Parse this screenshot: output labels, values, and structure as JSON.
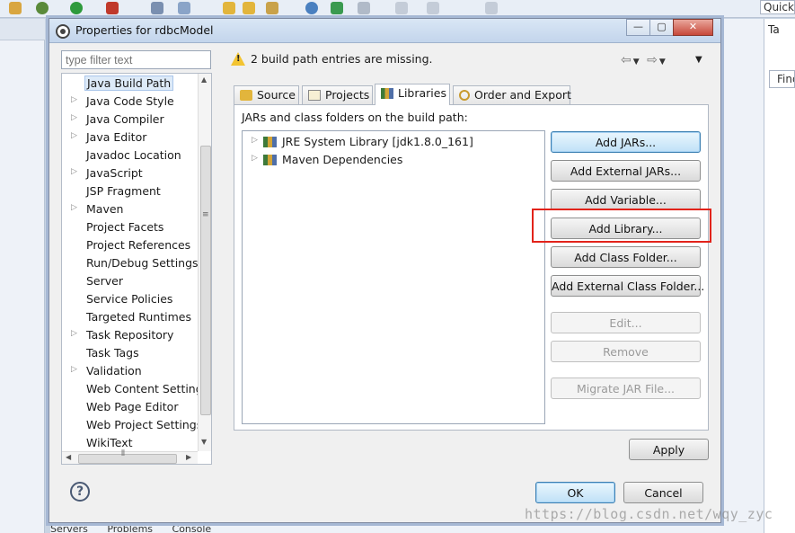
{
  "workbench": {
    "quick_access_label": "Quick",
    "right_tab_label": "Ta",
    "find_label": "Find",
    "bottom_tabs": [
      "Servers",
      "Problems",
      "Console"
    ]
  },
  "dialog": {
    "title": "Properties for rdbcModel",
    "window_buttons": {
      "minimize": "—",
      "maximize": "▢",
      "close": "✕"
    },
    "filter_placeholder": "type filter text",
    "tree_items": [
      {
        "label": "Java Build Path",
        "expandable": false,
        "selected": true
      },
      {
        "label": "Java Code Style",
        "expandable": true
      },
      {
        "label": "Java Compiler",
        "expandable": true
      },
      {
        "label": "Java Editor",
        "expandable": true
      },
      {
        "label": "Javadoc Location",
        "expandable": false
      },
      {
        "label": "JavaScript",
        "expandable": true
      },
      {
        "label": "JSP Fragment",
        "expandable": false
      },
      {
        "label": "Maven",
        "expandable": true
      },
      {
        "label": "Project Facets",
        "expandable": false
      },
      {
        "label": "Project References",
        "expandable": false
      },
      {
        "label": "Run/Debug Settings",
        "expandable": false
      },
      {
        "label": "Server",
        "expandable": false
      },
      {
        "label": "Service Policies",
        "expandable": false
      },
      {
        "label": "Targeted Runtimes",
        "expandable": false
      },
      {
        "label": "Task Repository",
        "expandable": true
      },
      {
        "label": "Task Tags",
        "expandable": false
      },
      {
        "label": "Validation",
        "expandable": true
      },
      {
        "label": "Web Content Settings",
        "expandable": false
      },
      {
        "label": "Web Page Editor",
        "expandable": false
      },
      {
        "label": "Web Project Settings",
        "expandable": false
      },
      {
        "label": "WikiText",
        "expandable": false
      }
    ],
    "message": "2 build path entries are missing.",
    "tabs": [
      {
        "label": "Source",
        "active": false
      },
      {
        "label": "Projects",
        "active": false
      },
      {
        "label": "Libraries",
        "active": true
      },
      {
        "label": "Order and Export",
        "active": false
      }
    ],
    "panel_label": "JARs and class folders on the build path:",
    "libraries": [
      {
        "label": "JRE System Library [jdk1.8.0_161]"
      },
      {
        "label": "Maven Dependencies"
      }
    ],
    "buttons": {
      "add_jars": "Add JARs...",
      "add_external_jars": "Add External JARs...",
      "add_variable": "Add Variable...",
      "add_library": "Add Library...",
      "add_class_folder": "Add Class Folder...",
      "add_external_class_folder": "Add External Class Folder...",
      "edit": "Edit...",
      "remove": "Remove",
      "migrate_jar": "Migrate JAR File...",
      "apply": "Apply",
      "ok": "OK",
      "cancel": "Cancel"
    },
    "help_symbol": "?"
  },
  "watermark": "https://blog.csdn.net/wqy_zyc",
  "colors": {
    "highlight_box": "#e2231a",
    "default_button_border": "#3c7fb1",
    "warning": "#f3c431"
  }
}
